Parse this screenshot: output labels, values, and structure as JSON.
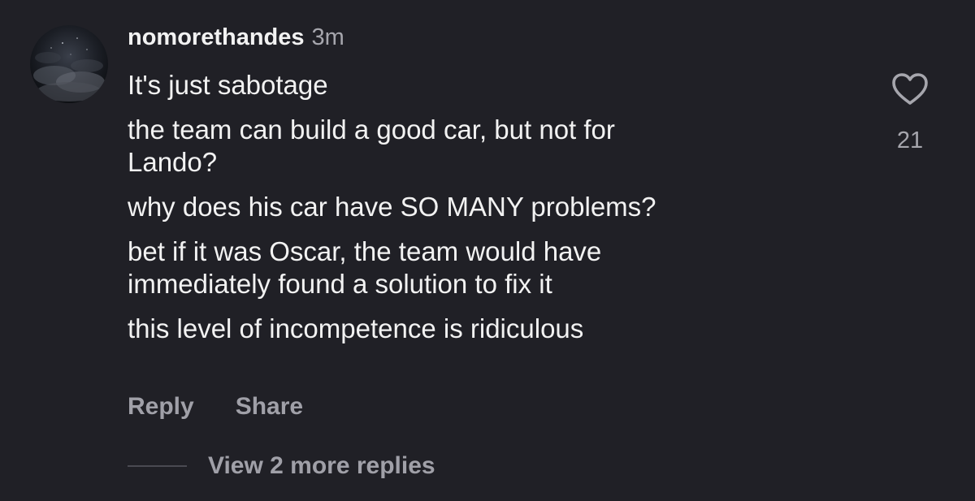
{
  "comment": {
    "avatar_icon": "cloudy-night-sky-avatar",
    "username": "nomorethandes",
    "timestamp": "3m",
    "lines": [
      "It's just sabotage",
      "the team can build a good car, but not for\nLando?",
      "why does his car have SO MANY problems?",
      "bet if it was Oscar, the team would have\nimmediately found a solution to fix it",
      "this level of incompetence is ridiculous"
    ],
    "actions": {
      "reply_label": "Reply",
      "share_label": "Share"
    },
    "likes": {
      "icon": "heart-outline-icon",
      "count": "21"
    },
    "more_replies_label": "View 2 more replies"
  },
  "colors": {
    "background": "#202026",
    "primary_text": "#f2f2f2",
    "secondary_text": "#a6a6ad"
  }
}
